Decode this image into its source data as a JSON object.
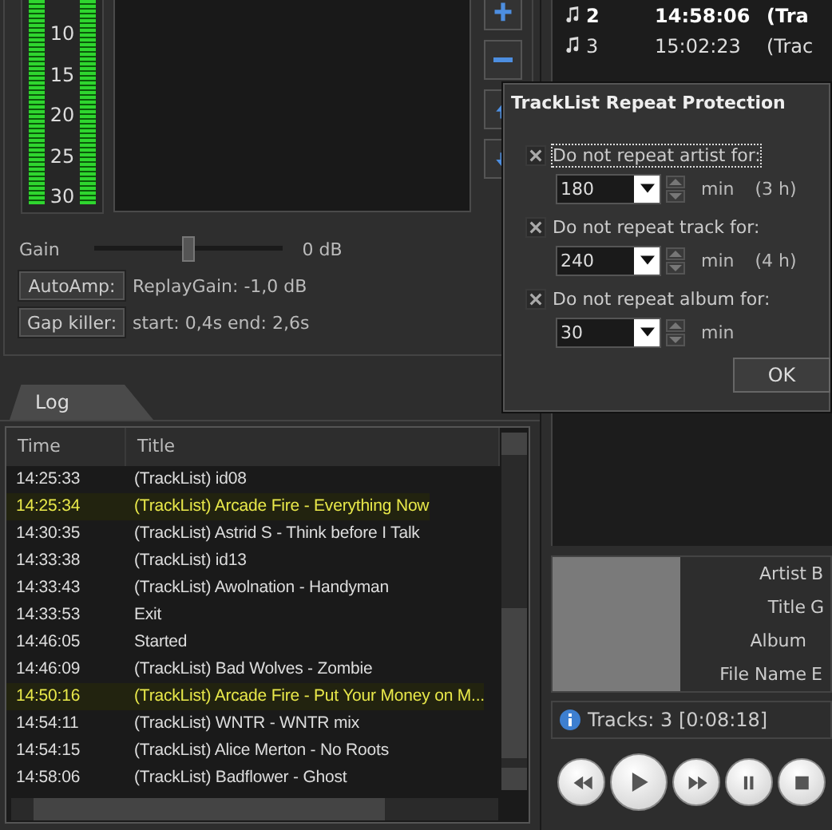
{
  "meter": {
    "scale": [
      "10",
      "15",
      "20",
      "25",
      "30"
    ]
  },
  "gain": {
    "label": "Gain",
    "level": 0.5,
    "reading": "0 dB"
  },
  "auto_amp": {
    "button": "AutoAmp:",
    "info": "ReplayGain: -1,0 dB"
  },
  "gap_killer": {
    "button": "Gap killer:",
    "info": "start: 0,4s end: 2,6s"
  },
  "log": {
    "tab": "Log",
    "columns": [
      "Time",
      "Title"
    ],
    "rows": [
      {
        "time": "14:25:33",
        "title": "(TrackList) id08",
        "highlighted": false
      },
      {
        "time": "14:25:34",
        "title": "(TrackList) Arcade Fire - Everything Now",
        "highlighted": true
      },
      {
        "time": "14:30:35",
        "title": "(TrackList) Astrid S - Think before I Talk",
        "highlighted": false
      },
      {
        "time": "14:33:38",
        "title": "(TrackList) id13",
        "highlighted": false
      },
      {
        "time": "14:33:43",
        "title": "(TrackList) Awolnation - Handyman",
        "highlighted": false
      },
      {
        "time": "14:33:53",
        "title": "Exit",
        "highlighted": false
      },
      {
        "time": "14:46:05",
        "title": "Started",
        "highlighted": false
      },
      {
        "time": "14:46:09",
        "title": "(TrackList) Bad Wolves - Zombie",
        "highlighted": false
      },
      {
        "time": "14:50:16",
        "title": "(TrackList) Arcade Fire - Put Your Money on M...",
        "highlighted": true
      },
      {
        "time": "14:54:11",
        "title": "(TrackList) WNTR - WNTR mix",
        "highlighted": false
      },
      {
        "time": "14:54:15",
        "title": "(TrackList) Alice Merton - No Roots",
        "highlighted": false
      },
      {
        "time": "14:58:06",
        "title": "(TrackList) Badflower - Ghost",
        "highlighted": false
      }
    ]
  },
  "playlist": {
    "rows": [
      {
        "number": "2",
        "time": "14:58:06",
        "title": "(Tra",
        "current": true
      },
      {
        "number": "3",
        "time": "15:02:23",
        "title": "(Trac",
        "current": false
      }
    ]
  },
  "track_info": {
    "fields": [
      {
        "label": "Artist",
        "value": "B"
      },
      {
        "label": "Title",
        "value": "G"
      },
      {
        "label": "Album"
      },
      {
        "label": "File Name",
        "value": "E"
      }
    ]
  },
  "status_bar": "Tracks: 3 [0:08:18]",
  "dialog": {
    "title": "TrackList Repeat Protection",
    "options": [
      {
        "label": "Do not repeat artist for:",
        "checked": true,
        "focused": true,
        "value": "180",
        "unit": "min",
        "note": "(3 h)"
      },
      {
        "label": "Do not repeat track for:",
        "checked": true,
        "focused": false,
        "value": "240",
        "unit": "min",
        "note": "(4 h)"
      },
      {
        "label": "Do not repeat album for:",
        "checked": true,
        "focused": false,
        "value": "30",
        "unit": "min"
      }
    ],
    "ok_button": "OK"
  }
}
